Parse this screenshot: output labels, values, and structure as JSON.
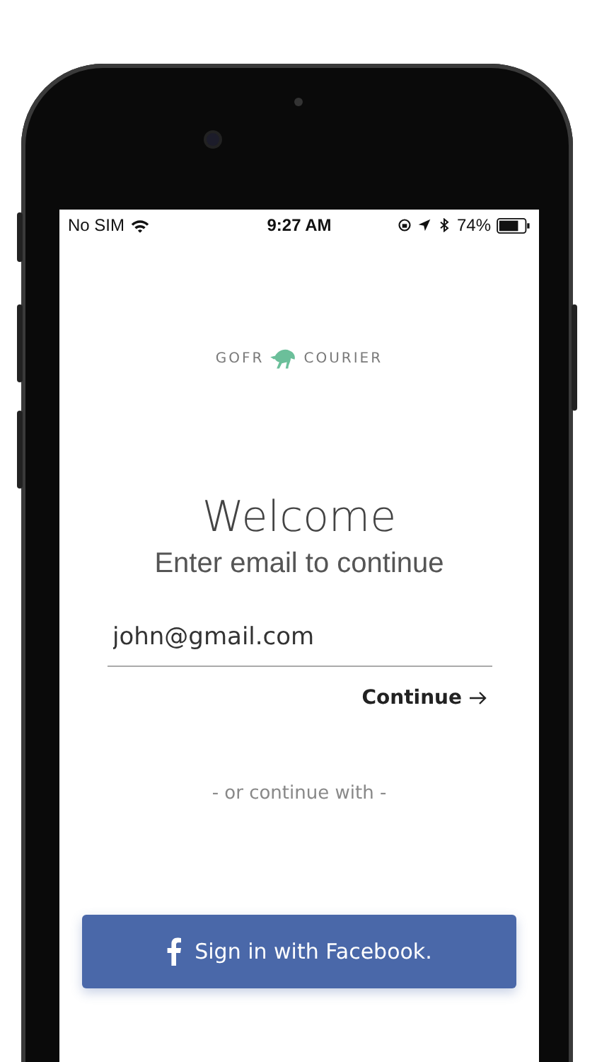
{
  "status_bar": {
    "carrier": "No SIM",
    "time": "9:27 AM",
    "battery": "74%"
  },
  "logo": {
    "left": "GOFR",
    "right": "COURIER"
  },
  "heading": "Welcome",
  "subtitle": "Enter email to continue",
  "email_field": {
    "value": "john@gmail.com"
  },
  "continue_button": {
    "label": "Continue"
  },
  "divider_text": "- or continue with -",
  "facebook_button": {
    "label": "Sign in with Facebook."
  }
}
